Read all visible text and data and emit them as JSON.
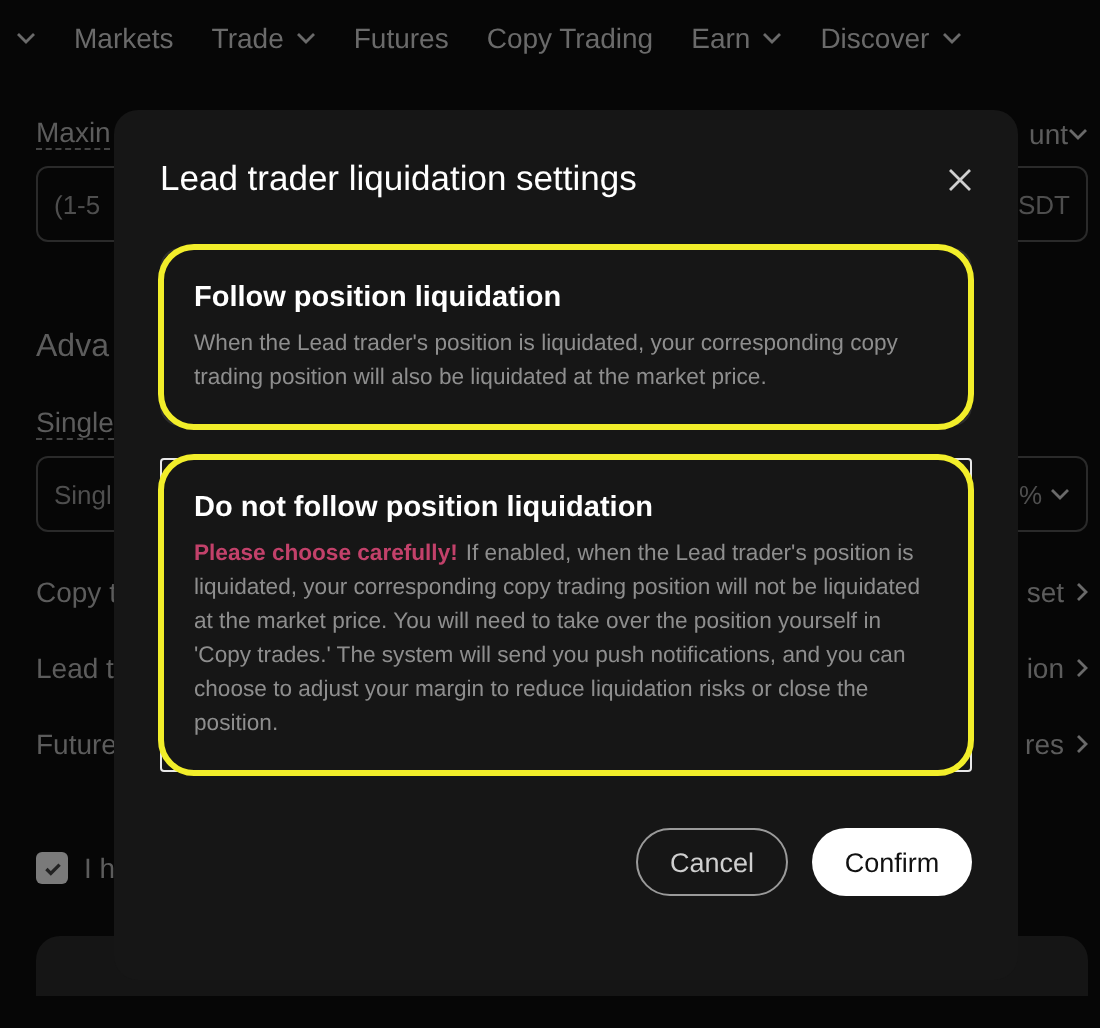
{
  "nav": [
    {
      "has_dropdown": true
    },
    {
      "label": "Markets",
      "has_dropdown": false
    },
    {
      "label": "Trade",
      "has_dropdown": true
    },
    {
      "label": "Futures",
      "has_dropdown": false
    },
    {
      "label": "Copy Trading",
      "has_dropdown": false
    },
    {
      "label": "Earn",
      "has_dropdown": true
    },
    {
      "label": "Discover",
      "has_dropdown": true
    }
  ],
  "background": {
    "max_label": "Maxin",
    "max_right": "unt",
    "max_placeholder": "(1-5",
    "max_unit": "SDT",
    "section": "Adva",
    "single_label": "Single",
    "single_value": "Singl",
    "single_unit": "%",
    "links": [
      {
        "left": "Copy t",
        "right": "set"
      },
      {
        "left": "Lead t",
        "right": "ion"
      },
      {
        "left": "Future",
        "right": "res"
      }
    ],
    "agree": {
      "label": "I h",
      "checked": true
    }
  },
  "dialog": {
    "title": "Lead trader liquidation settings",
    "options": [
      {
        "title": "Follow position liquidation",
        "description": "When the Lead trader's position is liquidated, your corresponding copy trading position will also be liquidated at the market price.",
        "selected": false,
        "highlighted": true
      },
      {
        "title": "Do not follow position liquidation",
        "warning": "Please choose carefully!",
        "description": "If enabled, when the Lead trader's position is liquidated, your corresponding copy trading position will not be liquidated at the market price. You will need to take over the position yourself in 'Copy trades.' The system will send you push notifications, and you can choose to adjust your margin to reduce liquidation risks or close the position.",
        "selected": true,
        "highlighted": true
      }
    ],
    "buttons": [
      {
        "label": "Cancel",
        "kind": "secondary"
      },
      {
        "label": "Confirm",
        "kind": "primary"
      }
    ]
  }
}
